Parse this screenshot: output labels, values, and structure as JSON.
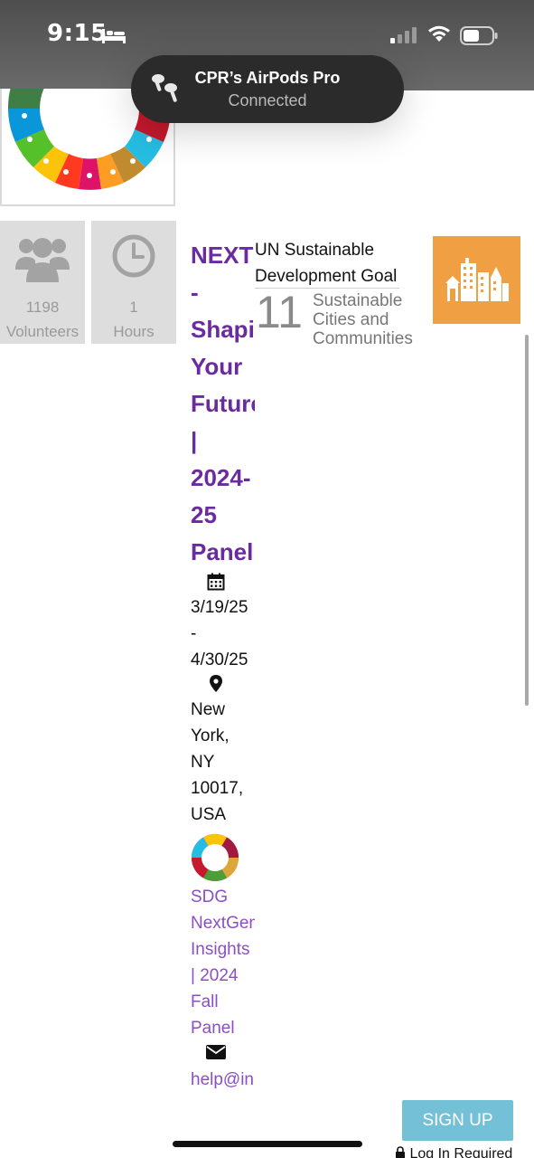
{
  "status_bar": {
    "time": "9:15",
    "icons": [
      "bed-icon",
      "cellular-signal-icon",
      "wifi-icon",
      "battery-icon"
    ]
  },
  "airpods_banner": {
    "title": "CPR’s AirPods Pro",
    "status": "Connected"
  },
  "stats": [
    {
      "icon": "users-icon",
      "value": "1198",
      "label": "Volunteers"
    },
    {
      "icon": "clock-icon",
      "value": "1",
      "label": "Hours"
    }
  ],
  "event": {
    "title_lines": [
      "NEXT",
      "-",
      "Shapi",
      "Your",
      "Future",
      "|",
      "2024-",
      "25",
      "Panel"
    ],
    "date_lines": [
      "3/19/25",
      "-",
      "4/30/25"
    ],
    "location_lines": [
      "New",
      "York,",
      "NY",
      "10017,",
      "USA"
    ],
    "org_lines": [
      "SDG",
      "NextGen",
      "Insights",
      "| 2024",
      "Fall",
      "Panel"
    ],
    "email": "help@in"
  },
  "sdg": {
    "heading_line1": "UN Sustainable",
    "heading_line2": "Development Goal",
    "number": "11",
    "name_lines": [
      "Sustainable",
      "Cities and",
      "Communities"
    ],
    "tile_color": "#f0a042"
  },
  "actions": {
    "signup": "SIGN UP",
    "login_required": "Log In Required"
  },
  "colors": {
    "accent_purple": "#6a2aa0",
    "link_purple": "#8a4fc4",
    "signup_blue": "#74c0d6"
  }
}
